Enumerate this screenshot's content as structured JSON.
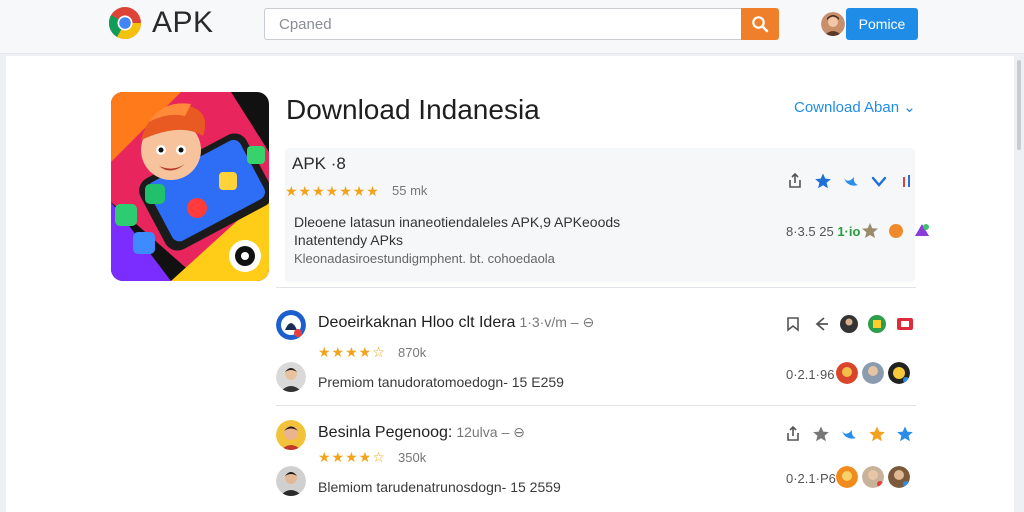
{
  "header": {
    "brand": "APK",
    "search_placeholder": "Cpaned",
    "primary_button": "Pomice"
  },
  "app": {
    "title": "Download Indanesia",
    "download_link": "Cownload Aban ⌄",
    "version": "APK ·8",
    "stars": "★★★★★★★",
    "rating_count": "55 mk",
    "desc_line1": "Dleoene latasun inaneotiendaleles APK,9 APKeoods",
    "desc_line2": "Inatentendy APks",
    "desc_line3": "Kleonadasiroestundigmphent. bt. cohoedaola",
    "meta_num": "8·3.5 25",
    "meta_green": "1·io"
  },
  "list": [
    {
      "title": "Deoeirkaknan Hloo clt Idera",
      "sub": "1·3·v/m  –  ⊖",
      "stars": "★★★★☆",
      "count": "870k",
      "text": "Premiom tanudoratomoedogn- 15 E259",
      "meta_num": "0·2.1·96"
    },
    {
      "title": "Besinla Pegenoog:",
      "sub": "12ulva  –  ⊖",
      "stars": "★★★★☆",
      "count": "350k",
      "text": "Blemiom tarudenatrunosdogn- 15 2559",
      "meta_num": "0·2.1·P6"
    }
  ],
  "colors": {
    "accent_blue": "#1f8de8",
    "search_orange": "#f07f2c",
    "star_gold": "#f3a31b"
  }
}
